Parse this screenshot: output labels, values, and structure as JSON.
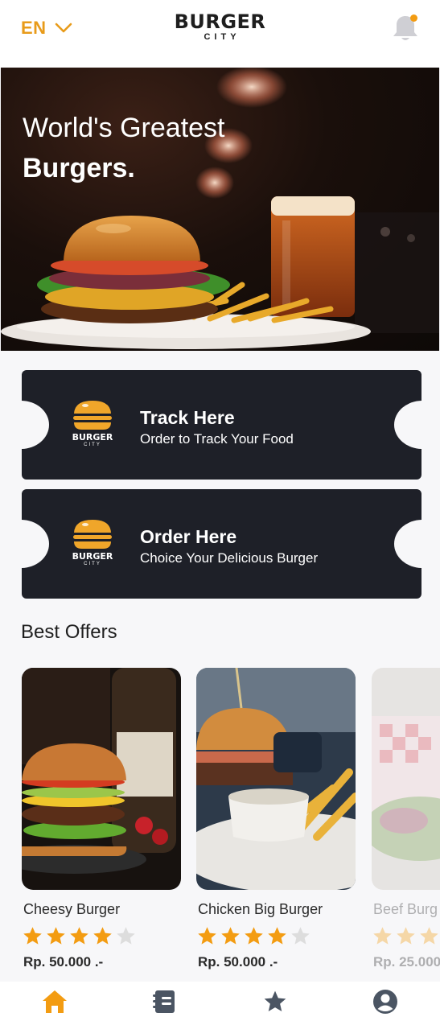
{
  "header": {
    "language": "EN",
    "logo_main": "BURGER",
    "logo_sub": "CITY",
    "notification_icon": "bell-icon"
  },
  "hero": {
    "title_line1": "World's Greatest",
    "title_line2": "Burgers."
  },
  "actions": [
    {
      "title": "Track Here",
      "subtitle": "Order to Track Your Food",
      "logo_text": "BURGER",
      "logo_sub": "CITY"
    },
    {
      "title": "Order Here",
      "subtitle": "Choice Your Delicious Burger",
      "logo_text": "BURGER",
      "logo_sub": "CITY"
    }
  ],
  "offers_title": "Best Offers",
  "offers": [
    {
      "name": "Cheesy Burger",
      "rating": 4,
      "max_rating": 5,
      "price": "Rp. 50.000 .-"
    },
    {
      "name": "Chicken Big Burger",
      "rating": 4,
      "max_rating": 5,
      "price": "Rp. 50.000 .-"
    },
    {
      "name": "Beef Burg",
      "rating": 5,
      "max_rating": 5,
      "price": "Rp. 25.000"
    }
  ],
  "bottom_nav": [
    {
      "icon": "home-icon",
      "active": true
    },
    {
      "icon": "menu-book-icon",
      "active": false
    },
    {
      "icon": "star-icon",
      "active": false
    },
    {
      "icon": "profile-icon",
      "active": false
    }
  ],
  "colors": {
    "accent": "#f39c12",
    "dark_card": "#1e2028",
    "inactive_icon": "#4b5563",
    "star_empty": "#dddddd"
  }
}
